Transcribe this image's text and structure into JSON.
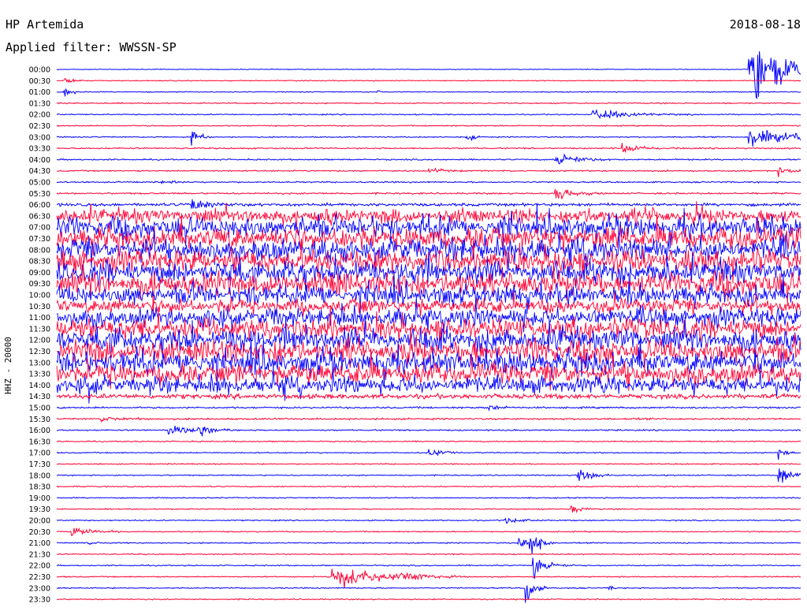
{
  "header": {
    "station": "HP Artemida",
    "date": "2018-08-18",
    "filter": "Applied filter: WWSSN-SP"
  },
  "chart_data": {
    "type": "line",
    "title": "HP Artemida",
    "ylabel": "HHZ - 20000",
    "xlabel": "",
    "colors": [
      "#0000ff",
      "#ff0033"
    ],
    "grid": false,
    "traces": [
      {
        "time": "00:00",
        "color": "#0000ff",
        "noise": 0.6,
        "events": [
          {
            "x": 0.93,
            "amp": 60,
            "dur": 0.06
          }
        ]
      },
      {
        "time": "00:30",
        "color": "#ff0033",
        "noise": 0.8,
        "events": [
          {
            "x": 0.01,
            "amp": 6,
            "dur": 0.015
          }
        ]
      },
      {
        "time": "01:00",
        "color": "#0000ff",
        "noise": 0.8,
        "events": [
          {
            "x": 0.01,
            "amp": 12,
            "dur": 0.01
          },
          {
            "x": 0.43,
            "amp": 6,
            "dur": 0.006
          }
        ]
      },
      {
        "time": "01:30",
        "color": "#ff0033",
        "noise": 1.0,
        "events": []
      },
      {
        "time": "02:00",
        "color": "#0000ff",
        "noise": 1.0,
        "events": [
          {
            "x": 0.72,
            "amp": 12,
            "dur": 0.05
          }
        ]
      },
      {
        "time": "02:30",
        "color": "#ff0033",
        "noise": 1.0,
        "events": []
      },
      {
        "time": "03:00",
        "color": "#0000ff",
        "noise": 1.0,
        "events": [
          {
            "x": 0.18,
            "amp": 26,
            "dur": 0.01
          },
          {
            "x": 0.55,
            "amp": 18,
            "dur": 0.008
          },
          {
            "x": 0.93,
            "amp": 18,
            "dur": 0.08
          }
        ]
      },
      {
        "time": "03:30",
        "color": "#ff0033",
        "noise": 1.2,
        "events": [
          {
            "x": 0.76,
            "amp": 10,
            "dur": 0.03
          }
        ]
      },
      {
        "time": "04:00",
        "color": "#0000ff",
        "noise": 1.2,
        "events": [
          {
            "x": 0.67,
            "amp": 16,
            "dur": 0.03
          }
        ]
      },
      {
        "time": "04:30",
        "color": "#ff0033",
        "noise": 1.2,
        "events": [
          {
            "x": 0.5,
            "amp": 6,
            "dur": 0.02
          },
          {
            "x": 0.97,
            "amp": 8,
            "dur": 0.03
          }
        ]
      },
      {
        "time": "05:00",
        "color": "#0000ff",
        "noise": 1.2,
        "events": [
          {
            "x": 0.14,
            "amp": 5,
            "dur": 0.02
          }
        ]
      },
      {
        "time": "05:30",
        "color": "#ff0033",
        "noise": 1.4,
        "events": [
          {
            "x": 0.67,
            "amp": 16,
            "dur": 0.025
          }
        ]
      },
      {
        "time": "06:00",
        "color": "#0000ff",
        "noise": 2.5,
        "events": [
          {
            "x": 0.18,
            "amp": 18,
            "dur": 0.03
          }
        ]
      },
      {
        "time": "06:30",
        "color": "#ff0033",
        "noise": 14,
        "events": []
      },
      {
        "time": "07:00",
        "color": "#0000ff",
        "noise": 20,
        "events": []
      },
      {
        "time": "07:30",
        "color": "#ff0033",
        "noise": 22,
        "events": []
      },
      {
        "time": "08:00",
        "color": "#0000ff",
        "noise": 22,
        "events": []
      },
      {
        "time": "08:30",
        "color": "#ff0033",
        "noise": 22,
        "events": []
      },
      {
        "time": "09:00",
        "color": "#0000ff",
        "noise": 22,
        "events": []
      },
      {
        "time": "09:30",
        "color": "#ff0033",
        "noise": 22,
        "events": []
      },
      {
        "time": "10:00",
        "color": "#0000ff",
        "noise": 18,
        "events": []
      },
      {
        "time": "10:30",
        "color": "#ff0033",
        "noise": 14,
        "events": []
      },
      {
        "time": "11:00",
        "color": "#0000ff",
        "noise": 18,
        "events": []
      },
      {
        "time": "11:30",
        "color": "#ff0033",
        "noise": 20,
        "events": []
      },
      {
        "time": "12:00",
        "color": "#0000ff",
        "noise": 22,
        "events": []
      },
      {
        "time": "12:30",
        "color": "#ff0033",
        "noise": 22,
        "events": []
      },
      {
        "time": "13:00",
        "color": "#0000ff",
        "noise": 22,
        "events": []
      },
      {
        "time": "13:30",
        "color": "#ff0033",
        "noise": 20,
        "events": []
      },
      {
        "time": "14:00",
        "color": "#0000ff",
        "noise": 16,
        "events": []
      },
      {
        "time": "14:30",
        "color": "#ff0033",
        "noise": 4,
        "events": []
      },
      {
        "time": "15:00",
        "color": "#0000ff",
        "noise": 1.5,
        "events": [
          {
            "x": 0.58,
            "amp": 6,
            "dur": 0.02
          }
        ]
      },
      {
        "time": "15:30",
        "color": "#ff0033",
        "noise": 1.5,
        "events": [
          {
            "x": 0.06,
            "amp": 6,
            "dur": 0.03
          }
        ]
      },
      {
        "time": "16:00",
        "color": "#0000ff",
        "noise": 1.2,
        "events": [
          {
            "x": 0.15,
            "amp": 10,
            "dur": 0.03
          },
          {
            "x": 0.19,
            "amp": 14,
            "dur": 0.02
          }
        ]
      },
      {
        "time": "16:30",
        "color": "#ff0033",
        "noise": 1.0,
        "events": []
      },
      {
        "time": "17:00",
        "color": "#0000ff",
        "noise": 1.0,
        "events": [
          {
            "x": 0.5,
            "amp": 10,
            "dur": 0.02
          },
          {
            "x": 0.97,
            "amp": 12,
            "dur": 0.01
          }
        ]
      },
      {
        "time": "17:30",
        "color": "#ff0033",
        "noise": 1.0,
        "events": []
      },
      {
        "time": "18:00",
        "color": "#0000ff",
        "noise": 1.0,
        "events": [
          {
            "x": 0.7,
            "amp": 16,
            "dur": 0.02
          },
          {
            "x": 0.97,
            "amp": 30,
            "dur": 0.015
          }
        ]
      },
      {
        "time": "18:30",
        "color": "#ff0033",
        "noise": 1.0,
        "events": []
      },
      {
        "time": "19:00",
        "color": "#0000ff",
        "noise": 1.0,
        "events": []
      },
      {
        "time": "19:30",
        "color": "#ff0033",
        "noise": 1.0,
        "events": [
          {
            "x": 0.69,
            "amp": 12,
            "dur": 0.015
          }
        ]
      },
      {
        "time": "20:00",
        "color": "#0000ff",
        "noise": 1.0,
        "events": [
          {
            "x": 0.6,
            "amp": 10,
            "dur": 0.02
          }
        ]
      },
      {
        "time": "20:30",
        "color": "#ff0033",
        "noise": 1.0,
        "events": [
          {
            "x": 0.02,
            "amp": 12,
            "dur": 0.03
          }
        ]
      },
      {
        "time": "21:00",
        "color": "#0000ff",
        "noise": 1.0,
        "events": [
          {
            "x": 0.04,
            "amp": 4,
            "dur": 0.02
          },
          {
            "x": 0.62,
            "amp": 14,
            "dur": 0.02
          },
          {
            "x": 0.635,
            "amp": 40,
            "dur": 0.012
          }
        ]
      },
      {
        "time": "21:30",
        "color": "#ff0033",
        "noise": 1.0,
        "events": []
      },
      {
        "time": "22:00",
        "color": "#0000ff",
        "noise": 1.0,
        "events": [
          {
            "x": 0.64,
            "amp": 26,
            "dur": 0.02
          }
        ]
      },
      {
        "time": "22:30",
        "color": "#ff0033",
        "noise": 1.0,
        "events": [
          {
            "x": 0.37,
            "amp": 22,
            "dur": 0.07
          },
          {
            "x": 0.46,
            "amp": 8,
            "dur": 0.03
          }
        ]
      },
      {
        "time": "23:00",
        "color": "#0000ff",
        "noise": 1.0,
        "events": [
          {
            "x": 0.63,
            "amp": 40,
            "dur": 0.01
          },
          {
            "x": 0.74,
            "amp": 5,
            "dur": 0.01
          }
        ]
      },
      {
        "time": "23:30",
        "color": "#ff0033",
        "noise": 1.0,
        "events": []
      }
    ]
  }
}
